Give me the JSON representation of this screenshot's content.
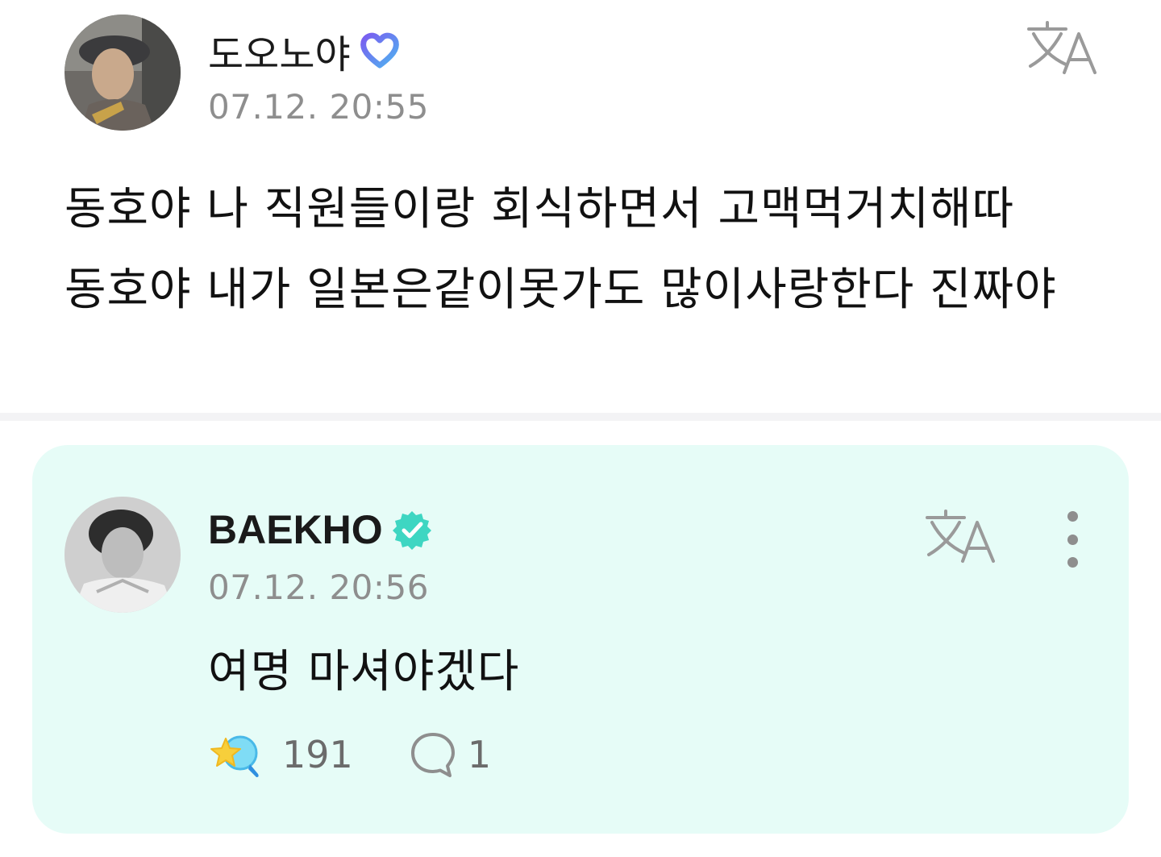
{
  "post": {
    "author": {
      "name": "도오노야",
      "badge_icon": "heart-membership-icon"
    },
    "timestamp": "07.12. 20:55",
    "body_lines": [
      "동호야 나 직원들이랑 회식하면서 고맥먹거치해따",
      "동호야 내가 일본은같이못가도 많이사랑한다 진짜야"
    ],
    "translate_icon": "translate-icon"
  },
  "reply": {
    "author": {
      "name": "BAEKHO",
      "badge_icon": "verified-check-icon"
    },
    "timestamp": "07.12. 20:56",
    "body": "여명 마셔야겠다",
    "translate_icon": "translate-icon",
    "more_icon": "more-vertical-icon",
    "like_count": "191",
    "comment_count": "1",
    "background_color": "#e6fcf7",
    "verified_color": "#3ed6c2"
  },
  "colors": {
    "badge_gradient_start": "#7a5cf0",
    "badge_gradient_end": "#4fb3f0",
    "muted_text": "#8e8e8e"
  }
}
